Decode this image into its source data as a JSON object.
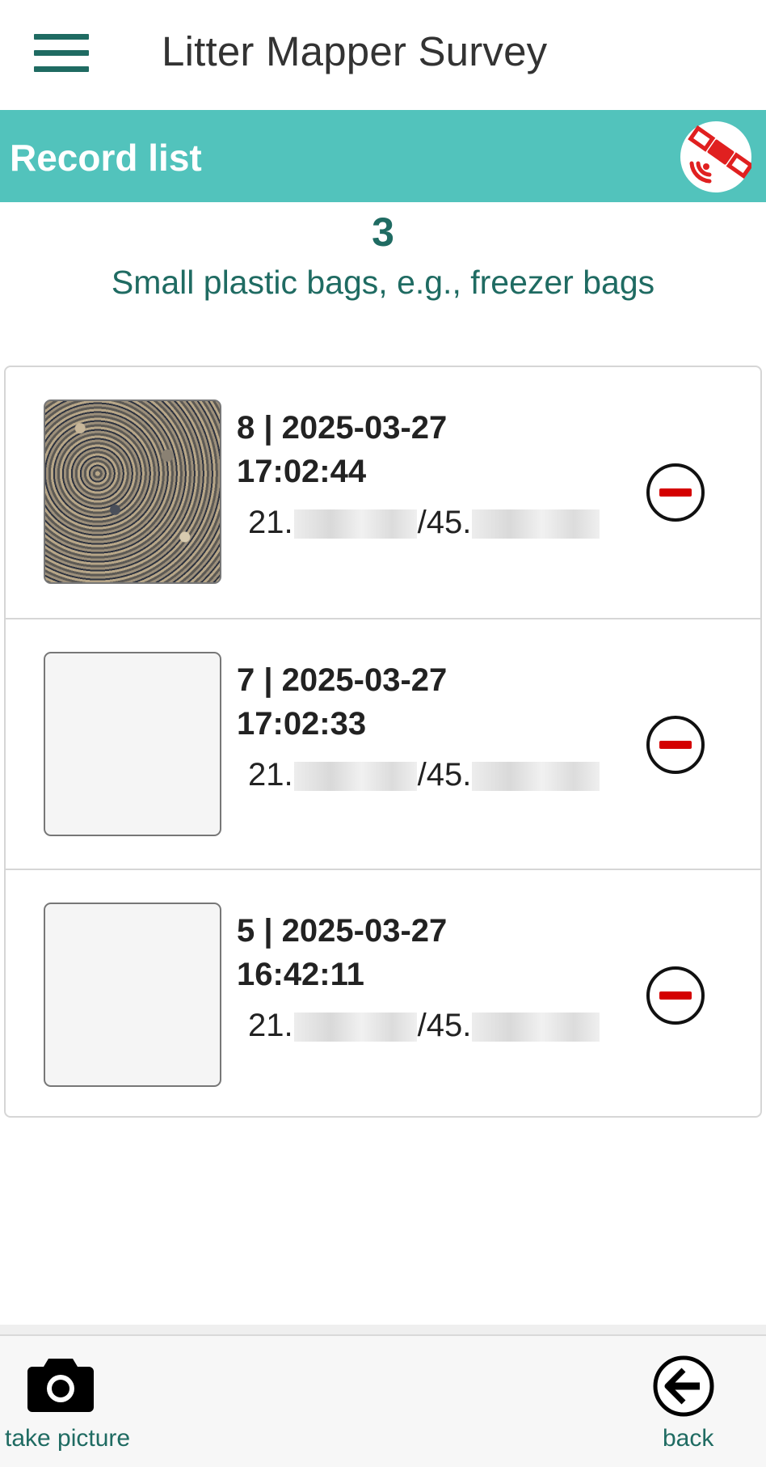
{
  "app": {
    "title": "Litter Mapper Survey"
  },
  "section": {
    "title": "Record list"
  },
  "summary": {
    "count": "3",
    "category": "Small plastic bags, e.g., freezer bags"
  },
  "records": [
    {
      "title": "8 | 2025-03-27",
      "time": "17:02:44",
      "lat_prefix": "21.",
      "lon_prefix": "/45.",
      "has_photo": true
    },
    {
      "title": "7 | 2025-03-27",
      "time": "17:02:33",
      "lat_prefix": "21.",
      "lon_prefix": "/45.",
      "has_photo": false
    },
    {
      "title": "5 | 2025-03-27",
      "time": "16:42:11",
      "lat_prefix": "21.",
      "lon_prefix": "/45.",
      "has_photo": false
    }
  ],
  "bottom": {
    "take_picture": "take picture",
    "back": "back"
  },
  "colors": {
    "teal_dark": "#1f6b62",
    "teal_header": "#52c3bc",
    "remove_red": "#d40000",
    "gps_red": "#e02020"
  },
  "icons": {
    "menu": "hamburger-menu-icon",
    "gps": "satellite-gps-icon",
    "remove": "minus-circle-icon",
    "camera": "camera-icon",
    "back": "arrow-left-circle-icon"
  }
}
